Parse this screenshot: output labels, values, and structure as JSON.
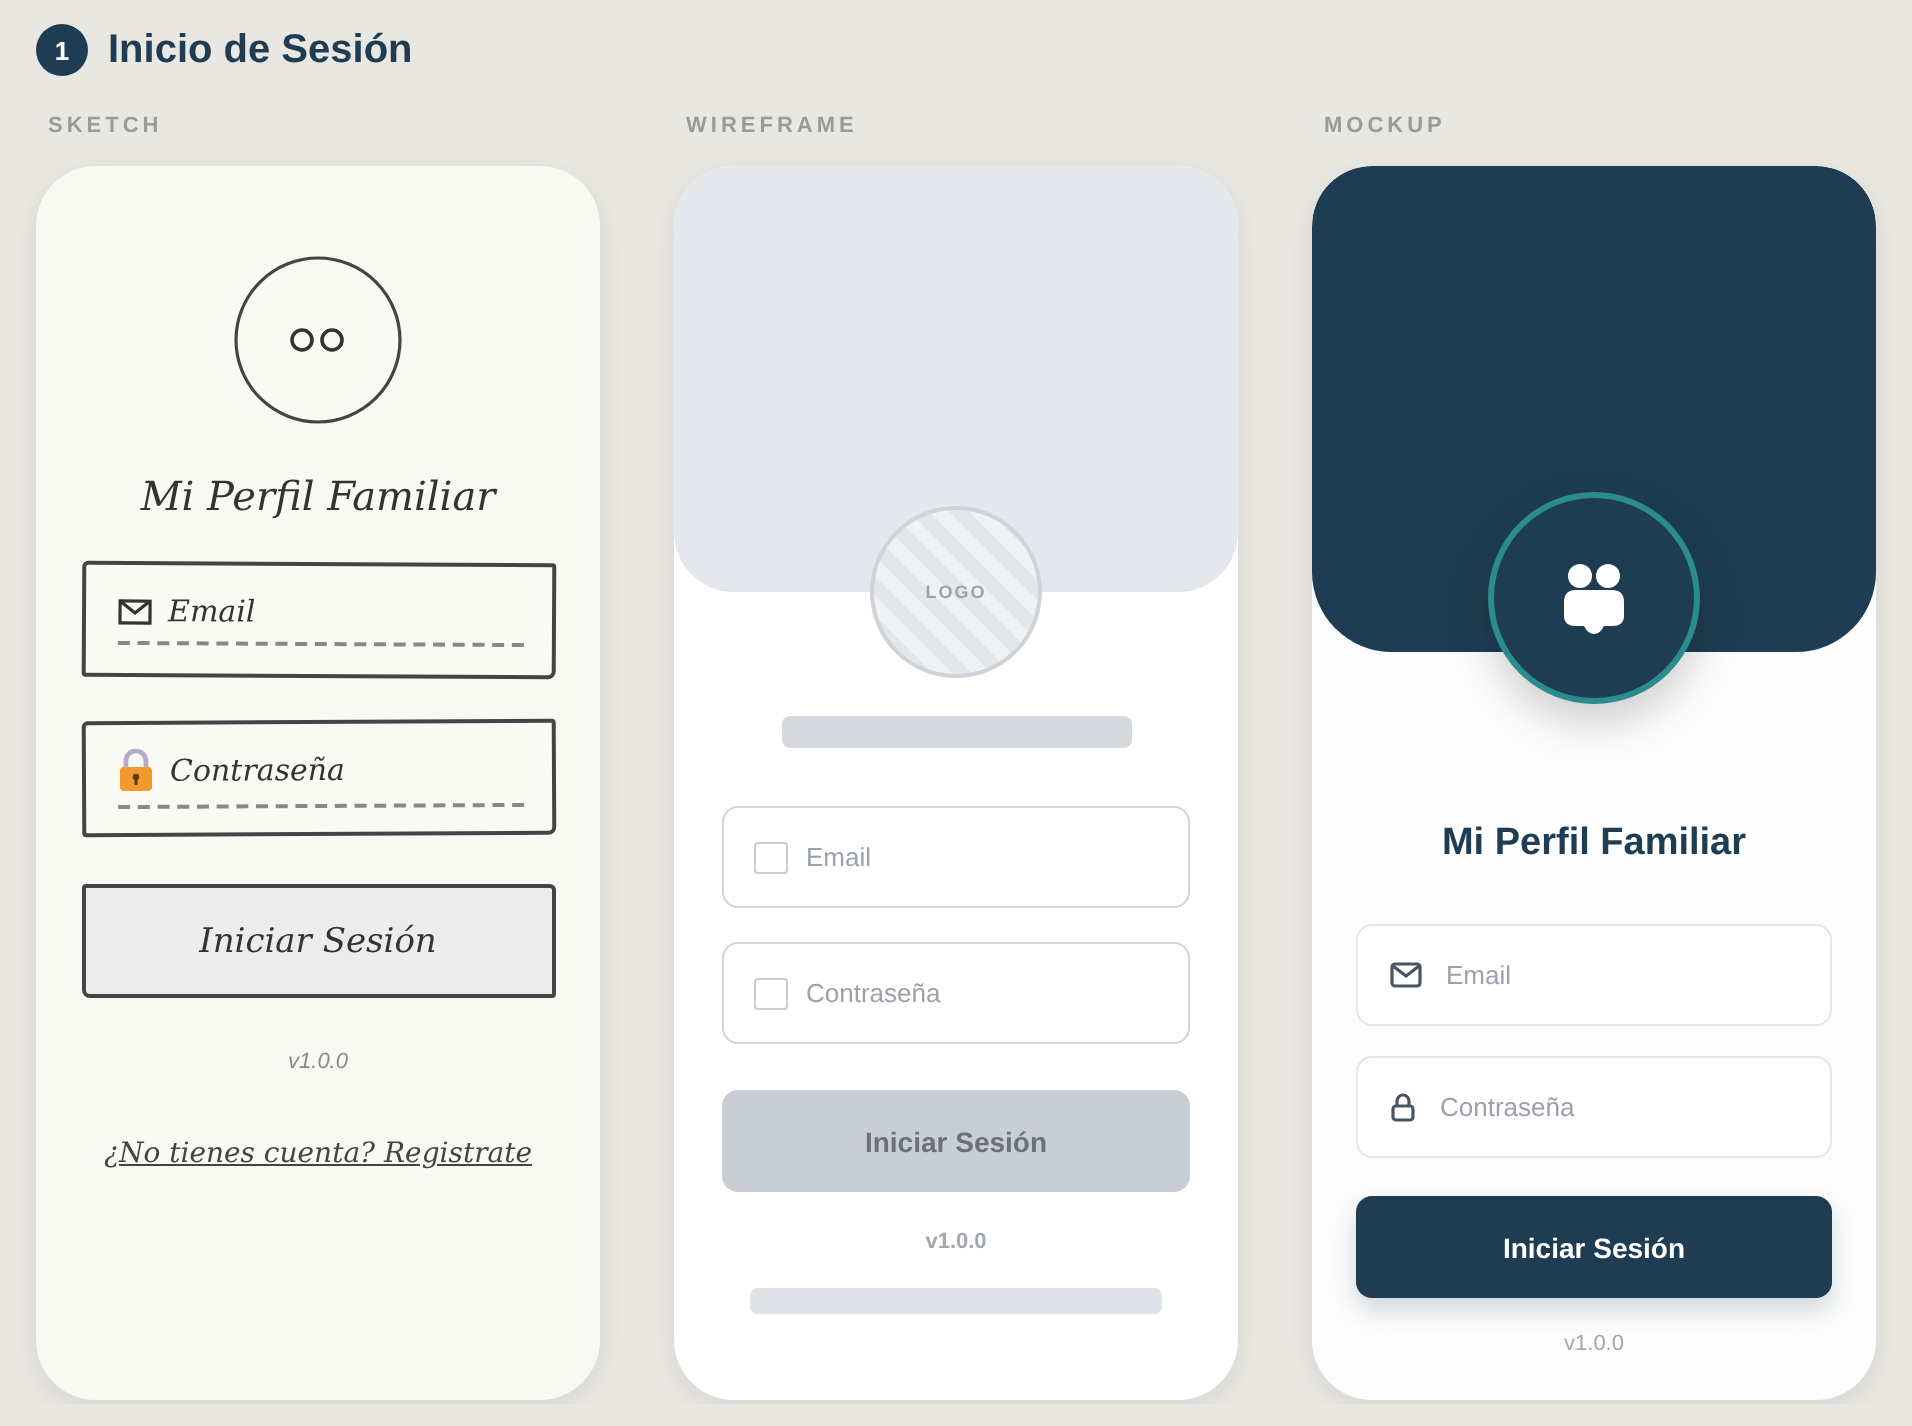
{
  "section": {
    "number": "1",
    "title": "Inicio de Sesión"
  },
  "panels": [
    {
      "kind": "sketch",
      "label": "SKETCH",
      "app_title": "Mi Perfil Familiar",
      "fields": [
        {
          "kind": "email",
          "placeholder": "Email"
        },
        {
          "kind": "password",
          "placeholder": "Contraseña"
        }
      ],
      "button": "Iniciar Sesión",
      "version": "v1.0.0",
      "link": "¿No tienes cuenta? Registrate"
    },
    {
      "kind": "wireframe",
      "label": "WIREFRAME",
      "logo": "LOGO",
      "fields": [
        {
          "placeholder": "Email"
        },
        {
          "placeholder": "Contraseña"
        }
      ],
      "button": "Iniciar Sesión",
      "version": "v1.0.0"
    },
    {
      "kind": "mockup",
      "label": "MOCKUP",
      "app_title": "Mi Perfil Familiar",
      "fields": [
        {
          "kind": "email",
          "placeholder": "Email"
        },
        {
          "kind": "password",
          "placeholder": "Contraseña"
        }
      ],
      "button": "Iniciar Sesión",
      "version": "v1.0.0"
    }
  ]
}
